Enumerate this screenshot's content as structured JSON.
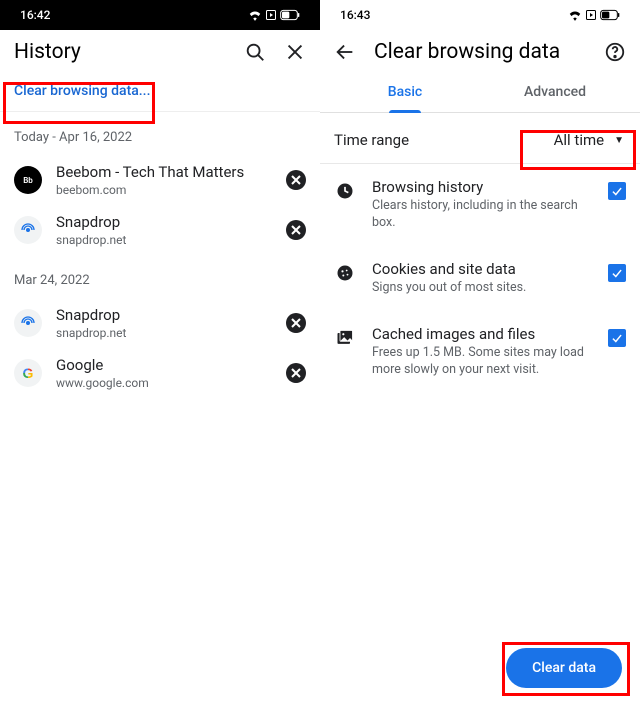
{
  "left": {
    "time": "16:42",
    "title": "History",
    "clear_link": "Clear browsing data...",
    "groups": [
      {
        "label": "Today - Apr 16, 2022",
        "items": [
          {
            "title": "Beebom - Tech That Matters",
            "url": "beebom.com",
            "icon": "beebom"
          },
          {
            "title": "Snapdrop",
            "url": "snapdrop.net",
            "icon": "snapdrop"
          }
        ]
      },
      {
        "label": "Mar 24, 2022",
        "items": [
          {
            "title": "Snapdrop",
            "url": "snapdrop.net",
            "icon": "snapdrop"
          },
          {
            "title": "Google",
            "url": "www.google.com",
            "icon": "google"
          }
        ]
      }
    ]
  },
  "right": {
    "time": "16:43",
    "title": "Clear browsing data",
    "tabs": {
      "basic": "Basic",
      "advanced": "Advanced",
      "active": "basic"
    },
    "timerange": {
      "label": "Time range",
      "value": "All time"
    },
    "options": [
      {
        "icon": "clock",
        "title": "Browsing history",
        "desc": "Clears history, including in the search box.",
        "checked": true
      },
      {
        "icon": "cookie",
        "title": "Cookies and site data",
        "desc": "Signs you out of most sites.",
        "checked": true
      },
      {
        "icon": "images",
        "title": "Cached images and files",
        "desc": "Frees up 1.5 MB. Some sites may load more slowly on your next visit.",
        "checked": true
      }
    ],
    "clear_button": "Clear data"
  }
}
